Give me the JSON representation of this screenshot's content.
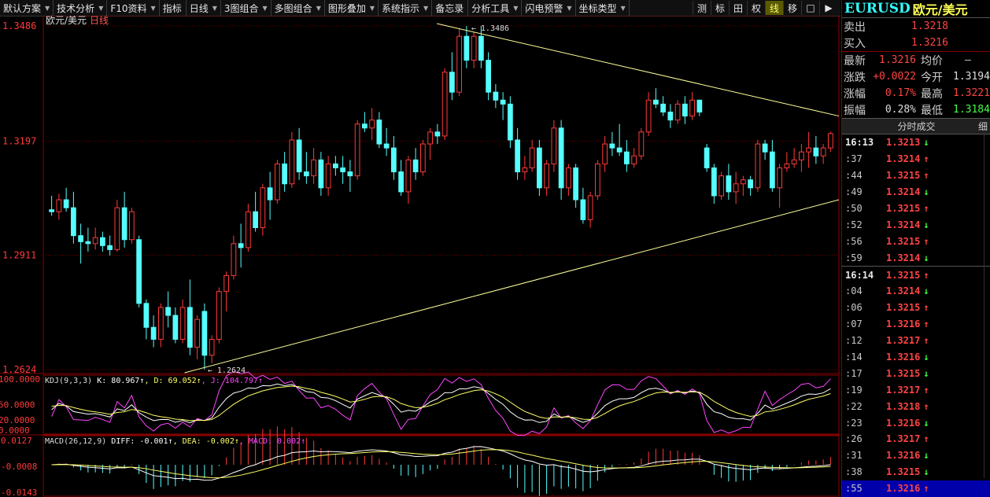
{
  "toolbar": {
    "items": [
      {
        "label": "默认方案",
        "dd": true
      },
      {
        "label": "技术分析",
        "dd": true
      },
      {
        "label": "F10资料",
        "dd": true
      },
      {
        "label": "指标",
        "dd": false
      },
      {
        "label": "日线",
        "dd": true
      },
      {
        "label": "3图组合",
        "dd": true
      },
      {
        "label": "多图组合",
        "dd": true
      },
      {
        "label": "图形叠加",
        "dd": true
      },
      {
        "label": "系统指示",
        "dd": true
      },
      {
        "label": "备忘录",
        "dd": false
      },
      {
        "label": "分析工具",
        "dd": true
      },
      {
        "label": "闪电预警",
        "dd": true
      },
      {
        "label": "坐标类型",
        "dd": true
      }
    ],
    "right": [
      "测",
      "标",
      "田",
      "权",
      "线",
      "移",
      "□",
      "▶"
    ],
    "active_right": "线"
  },
  "main_chart": {
    "title": "欧元/美元",
    "period": "日线",
    "price_labels": [
      "1.3486",
      "1.3197",
      "1.2911",
      "1.2624"
    ],
    "high_label": "1.3486",
    "low_label": "1.2624"
  },
  "kdj": {
    "label": "KDJ(9,3,3)",
    "k": "K: 80.967",
    "d": "D: 69.052",
    "j": "J: 104.797",
    "axis": [
      "100.0000",
      "50.0000",
      "20.0000",
      "0.0000"
    ]
  },
  "macd": {
    "label": "MACD(26,12,9)",
    "diff": "DIFF: -0.001",
    "dea": "DEA: -0.002",
    "macd": "MACD: 0.002",
    "axis": [
      "0.0127",
      "-0.0008",
      "-0.0143"
    ]
  },
  "colors": {
    "up": "#ff3a3a",
    "down": "#55ffff",
    "kline": "#ffffff",
    "dline": "#ffff66",
    "jline": "#ff44ff",
    "trend": "#ffff99"
  },
  "chart_data": {
    "type": "candlestick",
    "title": "欧元/美元 日线",
    "price_range": [
      1.2624,
      1.3486
    ],
    "candles": [
      [
        1.3025,
        1.306,
        1.301,
        1.302
      ],
      [
        1.302,
        1.3065,
        1.3,
        1.305
      ],
      [
        1.305,
        1.308,
        1.302,
        1.303
      ],
      [
        1.303,
        1.307,
        1.294,
        1.296
      ],
      [
        1.296,
        1.299,
        1.289,
        1.2945
      ],
      [
        1.2945,
        1.298,
        1.292,
        1.294
      ],
      [
        1.294,
        1.298,
        1.2925,
        1.2955
      ],
      [
        1.2955,
        1.297,
        1.292,
        1.2935
      ],
      [
        1.2935,
        1.296,
        1.291,
        1.2925
      ],
      [
        1.2925,
        1.305,
        1.292,
        1.303
      ],
      [
        1.303,
        1.307,
        1.293,
        1.295
      ],
      [
        1.295,
        1.303,
        1.294,
        1.302
      ],
      [
        1.295,
        1.296,
        1.278,
        1.279
      ],
      [
        1.279,
        1.28,
        1.27,
        1.273
      ],
      [
        1.273,
        1.276,
        1.268,
        1.27
      ],
      [
        1.27,
        1.279,
        1.268,
        1.278
      ],
      [
        1.278,
        1.282,
        1.273,
        1.276
      ],
      [
        1.276,
        1.278,
        1.269,
        1.27
      ],
      [
        1.27,
        1.28,
        1.269,
        1.278
      ],
      [
        1.278,
        1.285,
        1.266,
        1.268
      ],
      [
        1.268,
        1.276,
        1.265,
        1.275
      ],
      [
        1.277,
        1.279,
        1.2624,
        1.266
      ],
      [
        1.266,
        1.271,
        1.264,
        1.27
      ],
      [
        1.27,
        1.283,
        1.269,
        1.282
      ],
      [
        1.282,
        1.287,
        1.277,
        1.286
      ],
      [
        1.286,
        1.296,
        1.285,
        1.294
      ],
      [
        1.294,
        1.299,
        1.288,
        1.293
      ],
      [
        1.293,
        1.304,
        1.292,
        1.302
      ],
      [
        1.302,
        1.307,
        1.297,
        1.298
      ],
      [
        1.298,
        1.309,
        1.296,
        1.308
      ],
      [
        1.308,
        1.312,
        1.3,
        1.305
      ],
      [
        1.305,
        1.315,
        1.304,
        1.314
      ],
      [
        1.314,
        1.317,
        1.307,
        1.309
      ],
      [
        1.309,
        1.322,
        1.308,
        1.32
      ],
      [
        1.32,
        1.323,
        1.31,
        1.312
      ],
      [
        1.312,
        1.317,
        1.309,
        1.311
      ],
      [
        1.311,
        1.318,
        1.309,
        1.315
      ],
      [
        1.315,
        1.317,
        1.306,
        1.308
      ],
      [
        1.308,
        1.316,
        1.306,
        1.314
      ],
      [
        1.314,
        1.316,
        1.311,
        1.313
      ],
      [
        1.313,
        1.316,
        1.309,
        1.312
      ],
      [
        1.312,
        1.315,
        1.307,
        1.311
      ],
      [
        1.311,
        1.325,
        1.31,
        1.324
      ],
      [
        1.324,
        1.327,
        1.322,
        1.323
      ],
      [
        1.323,
        1.328,
        1.32,
        1.325
      ],
      [
        1.325,
        1.327,
        1.318,
        1.319
      ],
      [
        1.319,
        1.323,
        1.316,
        1.318
      ],
      [
        1.318,
        1.321,
        1.31,
        1.312
      ],
      [
        1.312,
        1.315,
        1.306,
        1.307
      ],
      [
        1.307,
        1.316,
        1.304,
        1.315
      ],
      [
        1.315,
        1.318,
        1.31,
        1.312
      ],
      [
        1.312,
        1.32,
        1.311,
        1.319
      ],
      [
        1.319,
        1.323,
        1.315,
        1.322
      ],
      [
        1.322,
        1.324,
        1.319,
        1.321
      ],
      [
        1.321,
        1.338,
        1.32,
        1.337
      ],
      [
        1.337,
        1.342,
        1.33,
        1.332
      ],
      [
        1.332,
        1.348,
        1.331,
        1.346
      ],
      [
        1.346,
        1.3486,
        1.338,
        1.34
      ],
      [
        1.34,
        1.347,
        1.338,
        1.346
      ],
      [
        1.346,
        1.3486,
        1.338,
        1.34
      ],
      [
        1.34,
        1.342,
        1.33,
        1.332
      ],
      [
        1.332,
        1.334,
        1.328,
        1.33
      ],
      [
        1.33,
        1.332,
        1.325,
        1.329
      ],
      [
        1.329,
        1.331,
        1.318,
        1.32
      ],
      [
        1.32,
        1.323,
        1.31,
        1.312
      ],
      [
        1.312,
        1.316,
        1.31,
        1.313
      ],
      [
        1.313,
        1.32,
        1.312,
        1.318
      ],
      [
        1.318,
        1.32,
        1.306,
        1.308
      ],
      [
        1.308,
        1.315,
        1.306,
        1.314
      ],
      [
        1.314,
        1.325,
        1.312,
        1.323
      ],
      [
        1.323,
        1.325,
        1.305,
        1.308
      ],
      [
        1.308,
        1.314,
        1.306,
        1.313
      ],
      [
        1.313,
        1.314,
        1.303,
        1.305
      ],
      [
        1.305,
        1.308,
        1.299,
        1.3
      ],
      [
        1.3,
        1.307,
        1.298,
        1.306
      ],
      [
        1.306,
        1.315,
        1.305,
        1.314
      ],
      [
        1.314,
        1.321,
        1.312,
        1.319
      ],
      [
        1.319,
        1.322,
        1.316,
        1.318
      ],
      [
        1.318,
        1.324,
        1.316,
        1.317
      ],
      [
        1.317,
        1.32,
        1.312,
        1.314
      ],
      [
        1.314,
        1.318,
        1.313,
        1.316
      ],
      [
        1.316,
        1.323,
        1.315,
        1.322
      ],
      [
        1.322,
        1.332,
        1.321,
        1.33
      ],
      [
        1.33,
        1.333,
        1.328,
        1.329
      ],
      [
        1.329,
        1.331,
        1.326,
        1.327
      ],
      [
        1.327,
        1.329,
        1.323,
        1.325
      ],
      [
        1.325,
        1.33,
        1.324,
        1.329
      ],
      [
        1.329,
        1.331,
        1.324,
        1.326
      ],
      [
        1.326,
        1.332,
        1.325,
        1.33
      ],
      [
        1.33,
        1.329,
        1.326,
        1.327
      ],
      [
        1.318,
        1.319,
        1.312,
        1.313
      ],
      [
        1.313,
        1.314,
        1.304,
        1.306
      ],
      [
        1.306,
        1.312,
        1.305,
        1.311
      ],
      [
        1.311,
        1.314,
        1.305,
        1.307
      ],
      [
        1.307,
        1.312,
        1.304,
        1.309
      ],
      [
        1.309,
        1.311,
        1.306,
        1.31
      ],
      [
        1.31,
        1.311,
        1.306,
        1.308
      ],
      [
        1.308,
        1.32,
        1.307,
        1.319
      ],
      [
        1.319,
        1.32,
        1.315,
        1.317
      ],
      [
        1.317,
        1.32,
        1.307,
        1.308
      ],
      [
        1.308,
        1.314,
        1.303,
        1.313
      ],
      [
        1.313,
        1.317,
        1.312,
        1.314
      ],
      [
        1.314,
        1.318,
        1.313,
        1.315
      ],
      [
        1.315,
        1.319,
        1.312,
        1.317
      ],
      [
        1.317,
        1.322,
        1.313,
        1.318
      ],
      [
        1.318,
        1.321,
        1.314,
        1.316
      ],
      [
        1.316,
        1.319,
        1.314,
        1.318
      ],
      [
        1.318,
        1.3221,
        1.317,
        1.3216
      ]
    ]
  }
}
